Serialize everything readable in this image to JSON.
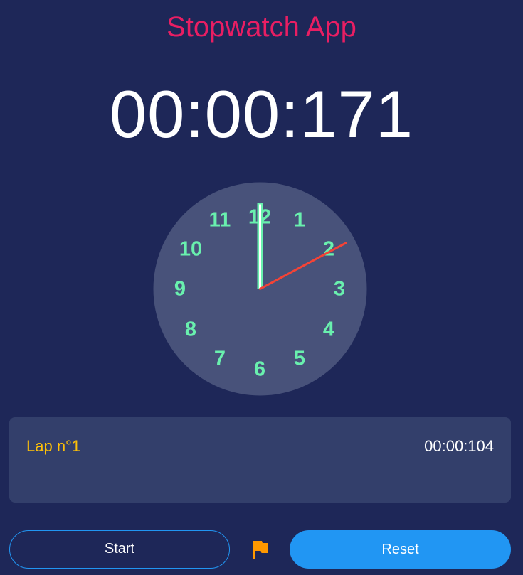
{
  "app": {
    "title": "Stopwatch App"
  },
  "display": {
    "time": "00:00:171"
  },
  "clock": {
    "numbers": [
      "12",
      "1",
      "2",
      "3",
      "4",
      "5",
      "6",
      "7",
      "8",
      "9",
      "10",
      "11"
    ],
    "minute_hand_position_minutes": 0,
    "second_hand_position_seconds": 10.3
  },
  "laps": [
    {
      "label": "Lap n°1",
      "time": "00:00:104"
    }
  ],
  "controls": {
    "start_label": "Start",
    "reset_label": "Reset",
    "lap_icon": "flag-icon"
  },
  "colors": {
    "background": "#1e2758",
    "title": "#e91e63",
    "clock_face": "#48527a",
    "clock_numbers": "#69f0ae",
    "second_hand": "#f44336",
    "lap_panel": "#333f6b",
    "lap_label": "#ffc107",
    "accent": "#2196f3",
    "flag": "#ff9800"
  }
}
